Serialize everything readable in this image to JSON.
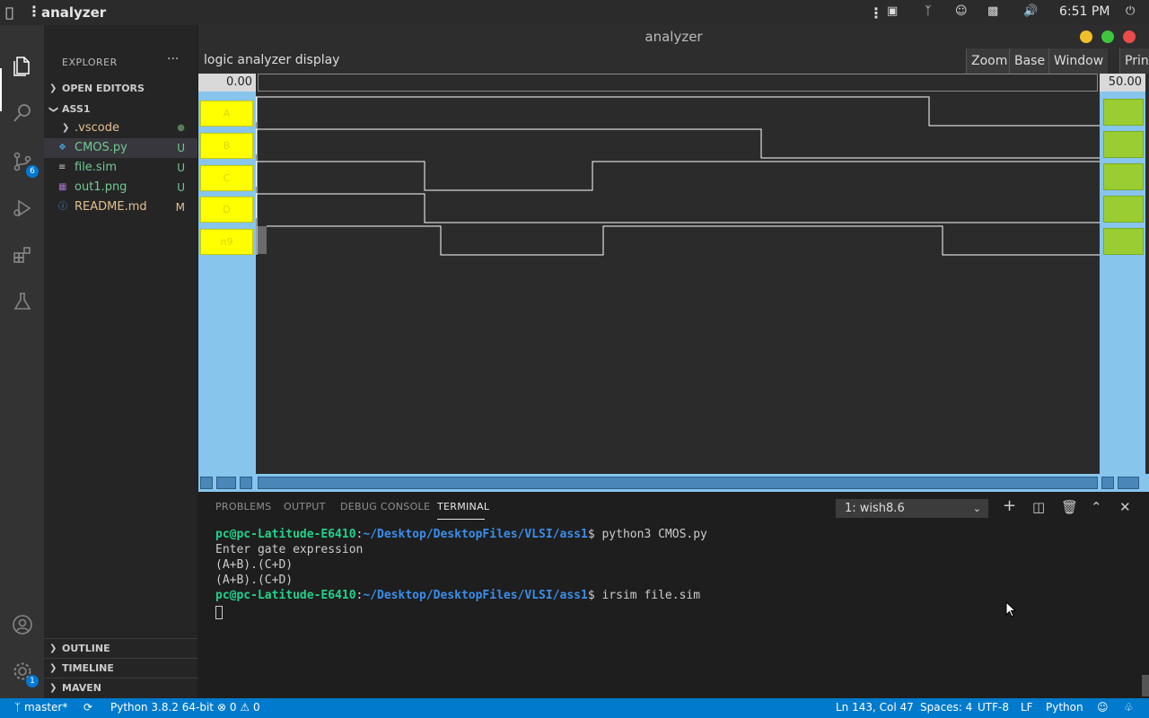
{
  "system_bar": {
    "app_name": "analyzer",
    "time": "6:51 PM"
  },
  "activity_bar": {
    "source_control_badge": "6",
    "settings_badge": "1"
  },
  "sidebar": {
    "title": "EXPLORER",
    "sections": {
      "open_editors": "OPEN EDITORS",
      "project": "ASS1",
      "outline": "OUTLINE",
      "timeline": "TIMELINE",
      "maven": "MAVEN"
    },
    "files": [
      {
        "name": ".vscode",
        "status": "●"
      },
      {
        "name": "CMOS.py",
        "status": "U"
      },
      {
        "name": "file.sim",
        "status": "U"
      },
      {
        "name": "out1.png",
        "status": "U"
      },
      {
        "name": "README.md",
        "status": "M"
      }
    ]
  },
  "analyzer": {
    "window_title": "analyzer",
    "display_label": "logic analyzer display",
    "buttons": [
      "Zoom",
      "Base",
      "Window",
      "Print"
    ],
    "time_start": "0.00",
    "time_end": "50.00",
    "signals": [
      "A",
      "B",
      "C",
      "D",
      "n9"
    ]
  },
  "panel": {
    "tabs": [
      "PROBLEMS",
      "OUTPUT",
      "DEBUG CONSOLE",
      "TERMINAL"
    ],
    "terminal_selector": "1: wish8.6",
    "lines": [
      {
        "user": "pc@pc-Latitude-E6410",
        "sep": ":",
        "path": "~/Desktop/DesktopFiles/VLSI/ass1",
        "cmd": "$ python3 CMOS.py"
      },
      {
        "text": "Enter gate expression"
      },
      {
        "text": "(A+B).(C+D)"
      },
      {
        "text": "(A+B).(C+D)"
      },
      {
        "user": "pc@pc-Latitude-E6410",
        "sep": ":",
        "path": "~/Desktop/DesktopFiles/VLSI/ass1",
        "cmd": "$ irsim file.sim"
      }
    ]
  },
  "status_bar": {
    "branch": "master*",
    "python": "Python 3.8.2 64-bit",
    "errors": "0",
    "warnings": "0",
    "position": "Ln 143, Col 47",
    "spaces": "Spaces: 4",
    "encoding": "UTF-8",
    "eol": "LF",
    "language": "Python"
  }
}
